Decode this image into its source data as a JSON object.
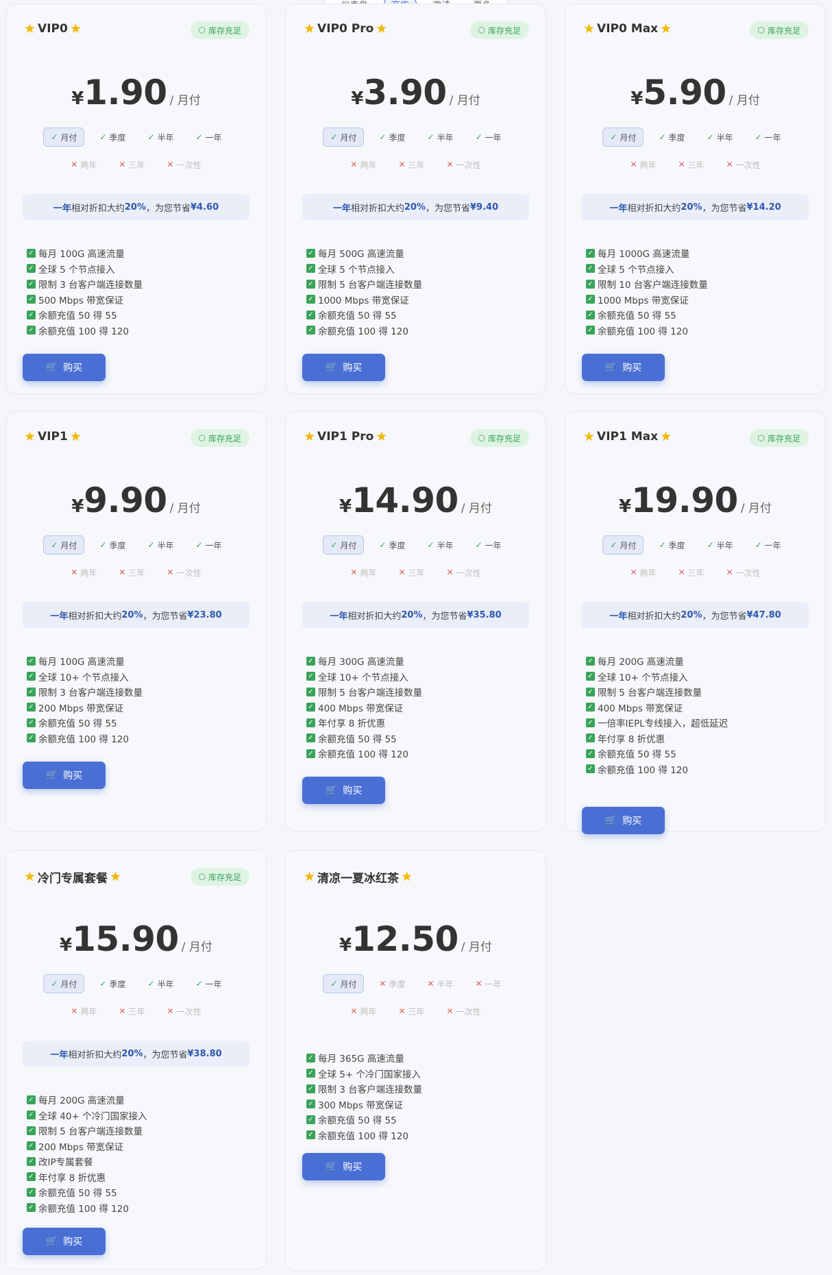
{
  "nav": {
    "items": [
      "仪表盘",
      "商店",
      "邀请",
      "更多"
    ],
    "active": 1
  },
  "labels": {
    "stock": "库存充足",
    "per_month": "/ 月付",
    "buy": "购买",
    "yen": "¥"
  },
  "plans": [
    {
      "name": "VIP0",
      "stock": true,
      "price": "1.90",
      "options": [
        [
          "月付",
          1,
          1
        ],
        [
          "季度",
          1,
          0
        ],
        [
          "半年",
          1,
          0
        ],
        [
          "一年",
          1,
          0
        ],
        [
          "两年",
          0,
          0
        ],
        [
          "三年",
          0,
          0
        ],
        [
          "一次性",
          0,
          0
        ]
      ],
      "discount": {
        "period": "一年",
        "text": " 相对折扣大约 ",
        "pct": "20%",
        "mid": "，为您节省 ",
        "save": "¥4.60"
      },
      "features": [
        "每月 100G 高速流量",
        "全球 5 个节点接入",
        "限制 3 台客户端连接数量",
        "500 Mbps 带宽保证",
        "余额充值 50 得 55",
        "余额充值 100 得 120"
      ]
    },
    {
      "name": "VIP0 Pro",
      "stock": true,
      "price": "3.90",
      "options": [
        [
          "月付",
          1,
          1
        ],
        [
          "季度",
          1,
          0
        ],
        [
          "半年",
          1,
          0
        ],
        [
          "一年",
          1,
          0
        ],
        [
          "两年",
          0,
          0
        ],
        [
          "三年",
          0,
          0
        ],
        [
          "一次性",
          0,
          0
        ]
      ],
      "discount": {
        "period": "一年",
        "text": " 相对折扣大约 ",
        "pct": "20%",
        "mid": "，为您节省 ",
        "save": "¥9.40"
      },
      "features": [
        "每月 500G 高速流量",
        "全球 5 个节点接入",
        "限制 5 台客户端连接数量",
        "1000 Mbps 带宽保证",
        "余额充值 50 得 55",
        "余额充值 100 得 120"
      ]
    },
    {
      "name": "VIP0 Max",
      "stock": true,
      "price": "5.90",
      "options": [
        [
          "月付",
          1,
          1
        ],
        [
          "季度",
          1,
          0
        ],
        [
          "半年",
          1,
          0
        ],
        [
          "一年",
          1,
          0
        ],
        [
          "两年",
          0,
          0
        ],
        [
          "三年",
          0,
          0
        ],
        [
          "一次性",
          0,
          0
        ]
      ],
      "discount": {
        "period": "一年",
        "text": " 相对折扣大约 ",
        "pct": "20%",
        "mid": "，为您节省 ",
        "save": "¥14.20"
      },
      "features": [
        "每月 1000G 高速流量",
        "全球 5 个节点接入",
        "限制 10 台客户端连接数量",
        "1000 Mbps 带宽保证",
        "余额充值 50 得 55",
        "余额充值 100 得 120"
      ]
    },
    {
      "name": "VIP1",
      "stock": true,
      "price": "9.90",
      "options": [
        [
          "月付",
          1,
          1
        ],
        [
          "季度",
          1,
          0
        ],
        [
          "半年",
          1,
          0
        ],
        [
          "一年",
          1,
          0
        ],
        [
          "两年",
          0,
          0
        ],
        [
          "三年",
          0,
          0
        ],
        [
          "一次性",
          0,
          0
        ]
      ],
      "discount": {
        "period": "一年",
        "text": " 相对折扣大约 ",
        "pct": "20%",
        "mid": "，为您节省 ",
        "save": "¥23.80"
      },
      "features": [
        "每月 100G 高速流量",
        "全球 10+ 个节点接入",
        "限制 3 台客户端连接数量",
        "200 Mbps 带宽保证",
        "余额充值 50 得 55",
        "余额充值 100 得 120"
      ]
    },
    {
      "name": "VIP1 Pro",
      "stock": true,
      "price": "14.90",
      "options": [
        [
          "月付",
          1,
          1
        ],
        [
          "季度",
          1,
          0
        ],
        [
          "半年",
          1,
          0
        ],
        [
          "一年",
          1,
          0
        ],
        [
          "两年",
          0,
          0
        ],
        [
          "三年",
          0,
          0
        ],
        [
          "一次性",
          0,
          0
        ]
      ],
      "discount": {
        "period": "一年",
        "text": " 相对折扣大约 ",
        "pct": "20%",
        "mid": "，为您节省 ",
        "save": "¥35.80"
      },
      "features": [
        "每月 300G 高速流量",
        "全球 10+ 个节点接入",
        "限制 5 台客户端连接数量",
        "400 Mbps 带宽保证",
        "年付享 8 折优惠",
        "余额充值 50 得 55",
        "余额充值 100 得 120"
      ]
    },
    {
      "name": "VIP1 Max",
      "stock": true,
      "price": "19.90",
      "options": [
        [
          "月付",
          1,
          1
        ],
        [
          "季度",
          1,
          0
        ],
        [
          "半年",
          1,
          0
        ],
        [
          "一年",
          1,
          0
        ],
        [
          "两年",
          0,
          0
        ],
        [
          "三年",
          0,
          0
        ],
        [
          "一次性",
          0,
          0
        ]
      ],
      "discount": {
        "period": "一年",
        "text": " 相对折扣大约 ",
        "pct": "20%",
        "mid": "，为您节省 ",
        "save": "¥47.80"
      },
      "features": [
        "每月 200G 高速流量",
        "全球 10+ 个节点接入",
        "限制 5 台客户端连接数量",
        "400 Mbps 带宽保证",
        "一倍率IEPL专线接入，超低延迟",
        "年付享 8 折优惠",
        "余额充值 50 得 55",
        "余额充值 100 得 120"
      ]
    },
    {
      "name": "冷门专属套餐",
      "stock": true,
      "price": "15.90",
      "options": [
        [
          "月付",
          1,
          1
        ],
        [
          "季度",
          1,
          0
        ],
        [
          "半年",
          1,
          0
        ],
        [
          "一年",
          1,
          0
        ],
        [
          "两年",
          0,
          0
        ],
        [
          "三年",
          0,
          0
        ],
        [
          "一次性",
          0,
          0
        ]
      ],
      "discount": {
        "period": "一年",
        "text": " 相对折扣大约 ",
        "pct": "20%",
        "mid": "，为您节省 ",
        "save": "¥38.80"
      },
      "features": [
        "每月 200G 高速流量",
        "全球 40+ 个冷门国家接入",
        "限制 5 台客户端连接数量",
        "200 Mbps 带宽保证",
        "改IP专属套餐",
        "年付享 8 折优惠",
        "余额充值 50 得 55",
        "余额充值 100 得 120"
      ]
    },
    {
      "name": "清凉一夏冰红茶",
      "stock": false,
      "price": "12.50",
      "options": [
        [
          "月付",
          1,
          1
        ],
        [
          "季度",
          0,
          0
        ],
        [
          "半年",
          0,
          0
        ],
        [
          "一年",
          0,
          0
        ],
        [
          "两年",
          0,
          0
        ],
        [
          "三年",
          0,
          0
        ],
        [
          "一次性",
          0,
          0
        ]
      ],
      "discount": null,
      "features": [
        "每月 365G 高速流量",
        "全球 5+ 个冷门国家接入",
        "限制 3 台客户端连接数量",
        "300 Mbps 带宽保证",
        "余额充值 50 得 55",
        "余额充值 100 得 120"
      ]
    }
  ]
}
